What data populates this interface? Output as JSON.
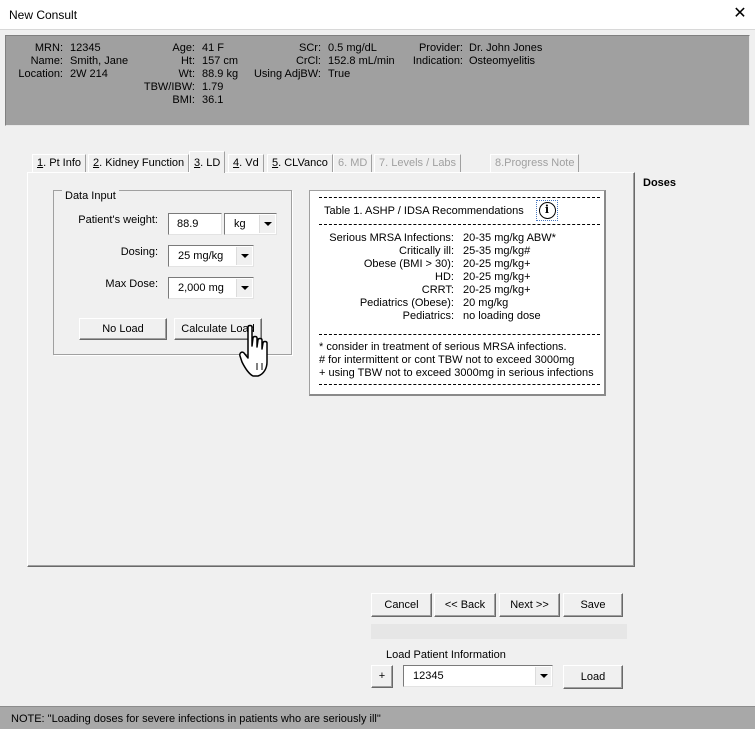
{
  "window": {
    "title": "New Consult",
    "close_glyph": "✕"
  },
  "patient": {
    "mrn_label": "MRN:",
    "mrn": "12345",
    "name_label": "Name:",
    "name": "Smith, Jane",
    "location_label": "Location:",
    "location": "2W 214",
    "age_label": "Age:",
    "age": "41 F",
    "ht_label": "Ht:",
    "ht": "157 cm",
    "wt_label": "Wt:",
    "wt": "88.9 kg",
    "tbw_ibw_label": "TBW/IBW:",
    "tbw_ibw": "1.79",
    "bmi_label": "BMI:",
    "bmi": "36.1",
    "scr_label": "SCr:",
    "scr": "0.5 mg/dL",
    "crcl_label": "CrCl:",
    "crcl": "152.8 mL/min",
    "adjbw_label": "Using AdjBW:",
    "adjbw": "True",
    "provider_label": "Provider:",
    "provider": "Dr. John Jones",
    "indication_label": "Indication:",
    "indication": "Osteomyelitis"
  },
  "tabs": [
    {
      "key": "1",
      "label": ". Pt Info",
      "state": "normal"
    },
    {
      "key": "2",
      "label": ". Kidney Function",
      "state": "normal"
    },
    {
      "key": "3",
      "label": ". LD",
      "state": "active"
    },
    {
      "key": "4",
      "label": ". Vd",
      "state": "normal"
    },
    {
      "key": "5",
      "label": ". CLVanco",
      "state": "normal"
    },
    {
      "key": "",
      "label": "6. MD",
      "state": "disabled"
    },
    {
      "key": "",
      "label": "7. Levels / Labs",
      "state": "disabled"
    },
    {
      "key": "",
      "label": "8.Progress Note",
      "state": "disabled"
    }
  ],
  "doses_label": "Doses",
  "data_input": {
    "legend": "Data Input",
    "weight_label": "Patient's weight:",
    "weight_value": "88.9",
    "weight_unit": "kg",
    "dosing_label": "Dosing:",
    "dosing_value": "25 mg/kg",
    "max_dose_label": "Max Dose:",
    "max_dose_value": "2,000 mg",
    "no_load_button": "No Load",
    "calculate_load_button": "Calculate Load"
  },
  "recommendations": {
    "title": "Table 1.  ASHP / IDSA Recommendations",
    "info_glyph": "i",
    "rows": [
      {
        "label": "Serious MRSA Infections:",
        "value": "20-35 mg/kg ABW*"
      },
      {
        "label": "Critically ill:",
        "value": "25-35 mg/kg#"
      },
      {
        "label": "Obese (BMI > 30):",
        "value": "20-25 mg/kg+"
      },
      {
        "label": "HD:",
        "value": "20-25 mg/kg+"
      },
      {
        "label": "CRRT:",
        "value": "20-25 mg/kg+"
      },
      {
        "label": "Pediatrics (Obese):",
        "value": "20 mg/kg"
      },
      {
        "label": "Pediatrics:",
        "value": "no loading dose"
      }
    ],
    "footnotes": [
      "* consider in treatment of serious MRSA infections.",
      "# for intermittent or cont TBW not to exceed 3000mg",
      "+ using TBW not to exceed 3000mg in serious infections"
    ]
  },
  "nav": {
    "cancel": "Cancel",
    "back": "<< Back",
    "next": "Next >>",
    "save": "Save"
  },
  "load_patient": {
    "label": "Load Patient Information",
    "add_button": "+",
    "selected": "12345",
    "load_button": "Load"
  },
  "status": {
    "note": "NOTE: \"Loading doses for severe infections in patients who are seriously ill\""
  }
}
